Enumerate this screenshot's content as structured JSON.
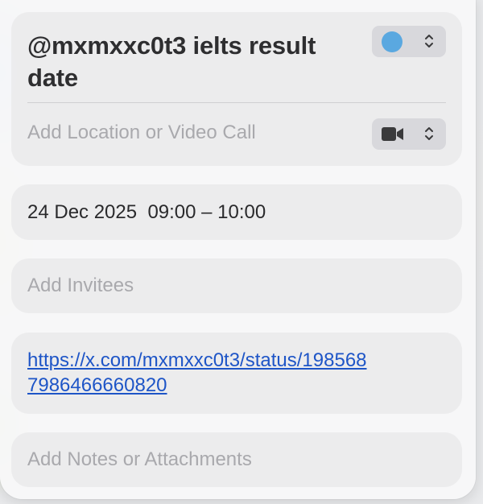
{
  "event": {
    "title": "@mxmxxc0t3 ielts result date",
    "calendar_color": "#5aa8e0",
    "calendar_icon": "chevron-up-down-icon",
    "location_placeholder": "Add Location or Video Call",
    "video_icon": "video-camera-icon",
    "date_time": "24 Dec 2025  09:00 – 10:00",
    "invitees_placeholder": "Add Invitees",
    "url": "https://x.com/mxmxxc0t3/status/1985687986466660820",
    "notes_placeholder": "Add Notes or Attachments"
  }
}
